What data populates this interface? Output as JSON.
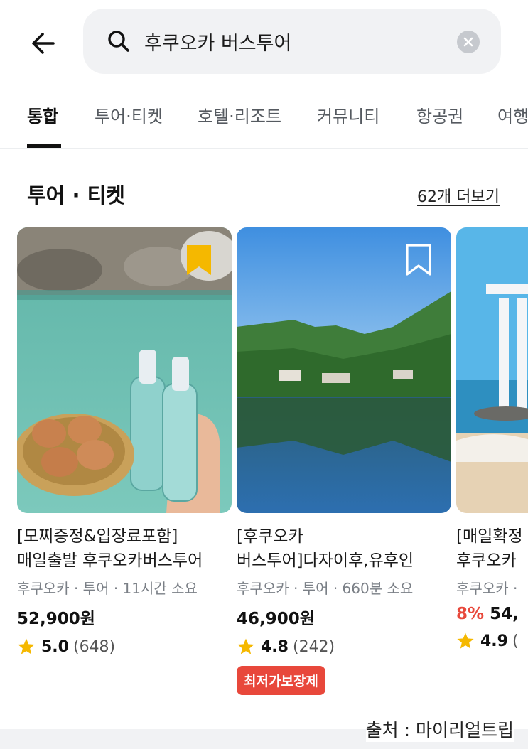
{
  "search": {
    "query": "후쿠오카 버스투어"
  },
  "tabs": [
    "통합",
    "투어·티켓",
    "호텔·리조트",
    "커뮤니티",
    "항공권",
    "여행"
  ],
  "section": {
    "title": "투어 · 티켓",
    "more": "62개 더보기"
  },
  "cards": [
    {
      "title_line1": "[모찌증정&입장료포함]",
      "title_line2": "매일출발 후쿠오카버스투어",
      "meta": "후쿠오카 · 투어 · 11시간 소요",
      "discount": "",
      "price": "52,900원",
      "rating": "5.0",
      "reviews": "(648)",
      "badge": "",
      "bookmarked": true
    },
    {
      "title_line1": "[후쿠오카",
      "title_line2": "버스투어]다자이후,유후인",
      "meta": "후쿠오카 · 투어 · 660분 소요",
      "discount": "",
      "price": "46,900원",
      "rating": "4.8",
      "reviews": "(242)",
      "badge": "최저가보장제",
      "bookmarked": false
    },
    {
      "title_line1": "[매일확정",
      "title_line2": "후쿠오카",
      "meta": "후쿠오카 ·",
      "discount": "8%",
      "price": "54,",
      "rating": "4.9",
      "reviews": "(",
      "badge": "",
      "bookmarked": false
    }
  ],
  "source": "출처 : 마이리얼트립",
  "colors": {
    "accent_red": "#e8483b",
    "bookmark_yellow": "#f5b800",
    "star": "#f5b800"
  }
}
